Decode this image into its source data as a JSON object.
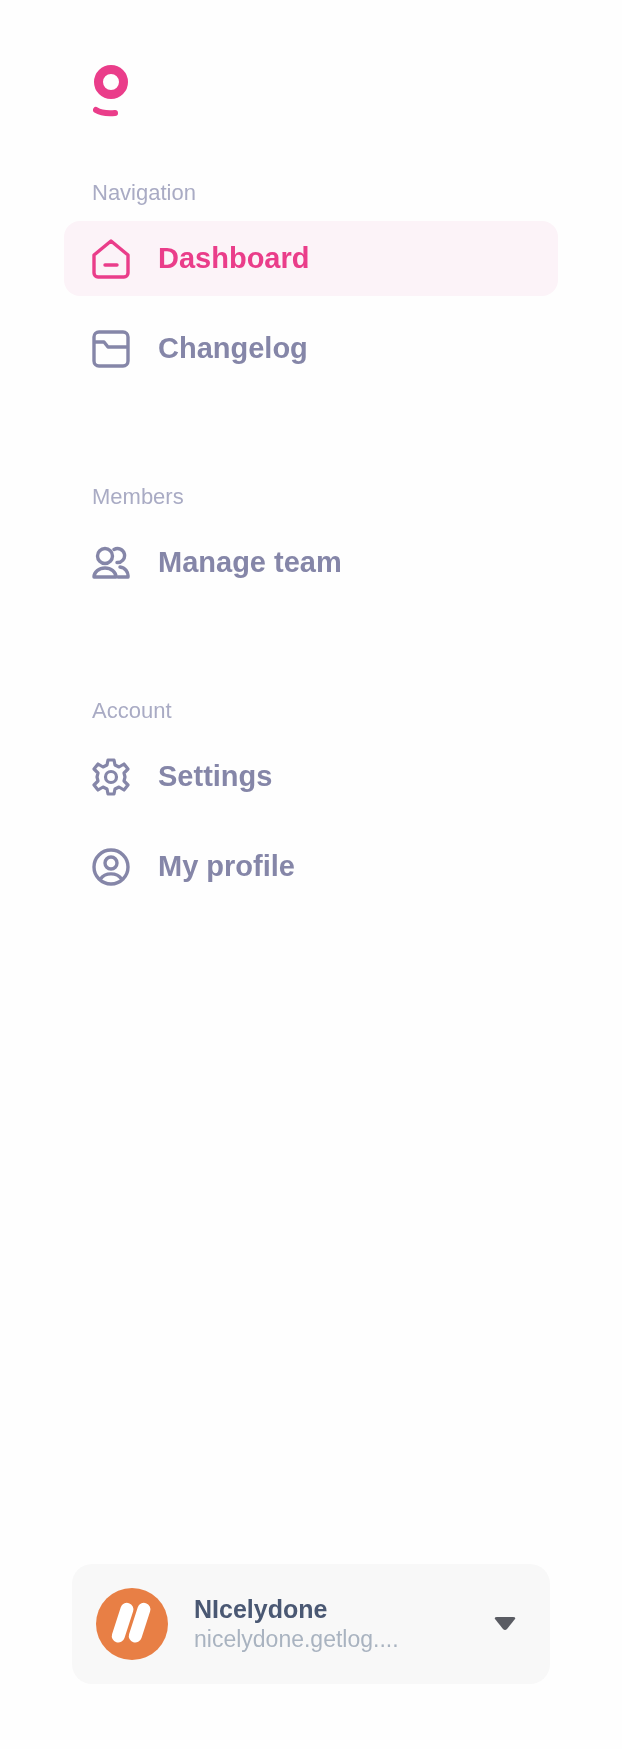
{
  "sections": [
    {
      "title": "Navigation",
      "items": [
        {
          "label": "Dashboard",
          "selected": true
        },
        {
          "label": "Changelog",
          "selected": false
        }
      ]
    },
    {
      "title": "Members",
      "items": [
        {
          "label": "Manage team",
          "selected": false
        }
      ]
    },
    {
      "title": "Account",
      "items": [
        {
          "label": "Settings",
          "selected": false
        },
        {
          "label": "My profile",
          "selected": false
        }
      ]
    }
  ],
  "account": {
    "name": "NIcelydone",
    "url": "nicelydone.getlog...."
  }
}
